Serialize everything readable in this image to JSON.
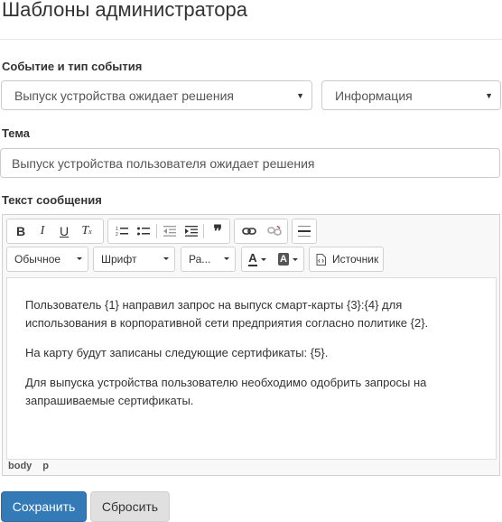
{
  "page": {
    "title": "Шаблоны администратора"
  },
  "event": {
    "label": "Событие и тип события",
    "event_value": "Выпуск устройства ожидает решения",
    "type_value": "Информация"
  },
  "subject": {
    "label": "Тема",
    "value": "Выпуск устройства пользователя ожидает решения"
  },
  "message": {
    "label": "Текст сообщения",
    "toolbar": {
      "format_label": "Обычное",
      "font_label": "Шрифт",
      "size_label": "Ра...",
      "source_label": "Источник"
    },
    "paragraphs": [
      "Пользователь {1} направил запрос на выпуск смарт-карты {3}:{4} для использования в корпоративной сети предприятия согласно политике {2}.",
      "На карту будут записаны следующие сертификаты: {5}.",
      "Для выпуска устройства пользователю необходимо одобрить запросы на запрашиваемые сертификаты."
    ],
    "path": [
      "body",
      "p"
    ]
  },
  "actions": {
    "save_label": "Сохранить",
    "reset_label": "Сбросить"
  }
}
